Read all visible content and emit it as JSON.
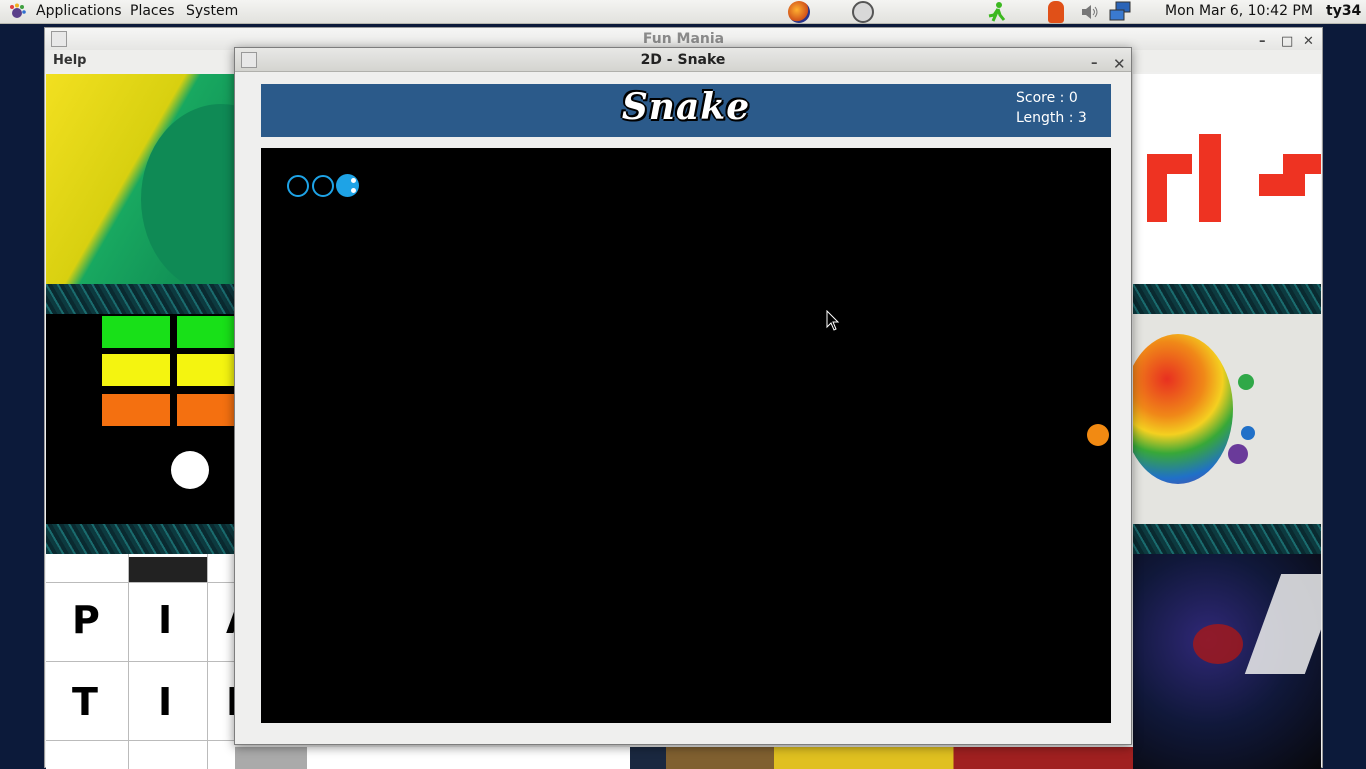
{
  "panel": {
    "menus": [
      "Applications",
      "Places",
      "System"
    ],
    "clock": "Mon Mar  6, 10:42 PM",
    "user": "ty34"
  },
  "fun_mania": {
    "title": "Fun Mania",
    "menu_help": "Help",
    "puzzle_letters": [
      "P",
      "I",
      "A",
      "T",
      "I",
      "I"
    ]
  },
  "snake_window": {
    "title": "2D - Snake",
    "logo": "Snake",
    "score_text": "Score : 0",
    "length_text": "Length : 3"
  },
  "colors": {
    "snake": "#1ea3e6",
    "food": "#f28a12",
    "header": "#2b5a8a",
    "board": "#000000"
  }
}
